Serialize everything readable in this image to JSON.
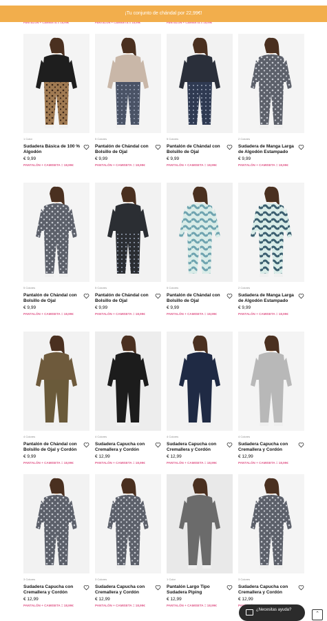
{
  "promo_banner": "¡Tu conjunto de chándal por 22,99€!",
  "peek_promo": [
    "PANTALÓN + CAMISETA = 18,99€",
    "PANTALÓN + CAMISETA = 18,99€",
    "PANTALÓN + CAMISETA = 18,99€"
  ],
  "products": [
    {
      "colors": "1 Color",
      "title": "Sudadera Básica de 100 % Algodón",
      "price": "€ 9,99",
      "promo": "PANTALÓN + CAMISETA = 18,99€",
      "outfit": {
        "top": "#1e1e1e",
        "bottom": "#8a6a48",
        "pattern": "leopard",
        "bg": "#f4f4f4"
      }
    },
    {
      "colors": "5 Colores",
      "title": "Pantalón de Chándal con Bolsillo de Ojal",
      "price": "€ 9,99",
      "promo": "PANTALÓN + CAMISETA = 18,99€",
      "outfit": {
        "top": "#c9b7a8",
        "bottom": "#4a5366",
        "pattern": "floral",
        "bg": "#f4f4f4"
      }
    },
    {
      "colors": "5 Colores",
      "title": "Pantalón de Chándal con Bolsillo de Ojal",
      "price": "€ 9,99",
      "promo": "PANTALÓN + CAMISETA = 18,99€",
      "outfit": {
        "top": "#2a2f3a",
        "bottom": "#2f3a52",
        "pattern": "floral",
        "bg": "#f2f2f2"
      }
    },
    {
      "colors": "2 Colores",
      "title": "Sudadera de Manga Larga de Algodón Estampado",
      "price": "€ 9,99",
      "promo": "PANTALÓN + CAMISETA = 18,99€",
      "outfit": {
        "top": "#3d4048",
        "bottom": "#3d4048",
        "pattern": "leopard-grey",
        "bg": "#f4f4f4"
      }
    },
    {
      "colors": "5 Colores",
      "title": "Pantalón de Chándal con Bolsillo de Ojal",
      "price": "€ 9,99",
      "promo": "PANTALÓN + CAMISETA = 18,99€",
      "outfit": {
        "top": "#3a3d44",
        "bottom": "#4c4f57",
        "pattern": "leopard-grey",
        "bg": "#f4f4f4"
      }
    },
    {
      "colors": "5 Colores",
      "title": "Pantalón de Chándal con Bolsillo de Ojal",
      "price": "€ 9,99",
      "promo": "PANTALÓN + CAMISETA = 18,99€",
      "outfit": {
        "top": "#2b2e33",
        "bottom": "#2b2e33",
        "pattern": "dots",
        "bg": "#f2f2f2"
      }
    },
    {
      "colors": "5 Colores",
      "title": "Pantalón de Chándal con Bolsillo de Ojal",
      "price": "€ 9,99",
      "promo": "PANTALÓN + CAMISETA = 18,99€",
      "outfit": {
        "top": "#7fb0b8",
        "bottom": "#6fa4b0",
        "pattern": "tiedye",
        "bg": "#f0f0f0"
      }
    },
    {
      "colors": "2 Colores",
      "title": "Sudadera de Manga Larga de Algodón Estampado",
      "price": "€ 9,99",
      "promo": "PANTALÓN + CAMISETA = 18,99€",
      "outfit": {
        "top": "#3b5f70",
        "bottom": "#3b5f70",
        "pattern": "tiedye",
        "bg": "#f4f4f4"
      }
    },
    {
      "colors": "4 Colores",
      "title": "Pantalón de Chándal con Bolsillo de Ojal y Cordón",
      "price": "€ 9,99",
      "promo": "PANTALÓN + CAMISETA = 18,99€",
      "outfit": {
        "top": "#6e5a3c",
        "bottom": "#6a5a3a",
        "pattern": "plain",
        "bg": "#f2f2f2"
      }
    },
    {
      "colors": "4 Colores",
      "title": "Sudadera Capucha con Cremallera y Cordón",
      "price": "€ 12,99",
      "promo": "PANTALÓN + CAMISETA = 18,99€",
      "outfit": {
        "top": "#1c1c1c",
        "bottom": "#1c1c1c",
        "pattern": "plain",
        "bg": "#ededed"
      }
    },
    {
      "colors": "4 Colores",
      "title": "Sudadera Capucha con Cremallera y Cordón",
      "price": "€ 12,99",
      "promo": "PANTALÓN + CAMISETA = 18,99€",
      "outfit": {
        "top": "#1f2a44",
        "bottom": "#1f2a44",
        "pattern": "plain",
        "bg": "#f2f2f2"
      }
    },
    {
      "colors": "4 Colores",
      "title": "Sudadera Capucha con Cremallera y Cordón",
      "price": "€ 12,99",
      "promo": "PANTALÓN + CAMISETA = 18,99€",
      "outfit": {
        "top": "#b8b8b8",
        "bottom": "#b8b8b8",
        "pattern": "plain",
        "bg": "#f4f4f4"
      }
    },
    {
      "colors": "3 Colores",
      "title": "Sudadera Capucha con Cremallera y Cordón",
      "price": "€ 12,99",
      "promo": "PANTALÓN + CAMISETA = 18,99€",
      "outfit": {
        "top": "#2a3340",
        "bottom": "#2a3340",
        "pattern": "leopard-grey",
        "bg": "#f2f2f2"
      }
    },
    {
      "colors": "3 Colores",
      "title": "Sudadera Capucha con Cremallera y Cordón",
      "price": "€ 12,99",
      "promo": "PANTALÓN + CAMISETA = 18,99€",
      "outfit": {
        "top": "#3a3f48",
        "bottom": "#3a3f48",
        "pattern": "leopard-grey",
        "bg": "#f4f4f4"
      }
    },
    {
      "colors": "1 Color",
      "title": "Pantalón Largo Tipo Sudadera Piping",
      "price": "€ 12,99",
      "promo": "PANTALÓN + CAMISETA = 18,99€",
      "outfit": {
        "top": "#6b6b6b",
        "bottom": "#6b6b6b",
        "pattern": "plain",
        "bg": "#e9e9e9"
      }
    },
    {
      "colors": "3 Colores",
      "title": "Sudadera Capucha con Cremallera y Cordón",
      "price": "€ 12,99",
      "promo": "PANTALÓN + CAMISETA = 18,99€",
      "outfit": {
        "top": "#4a5060",
        "bottom": "#4a5060",
        "pattern": "leopard-grey",
        "bg": "#f4f4f4"
      }
    }
  ],
  "chat_button": "¿Necesitas ayuda?",
  "scroll_top_icon": "chevron-up-icon",
  "colors": {
    "promo_bg": "#f2ae4c",
    "promo_text": "#e05a8a"
  }
}
